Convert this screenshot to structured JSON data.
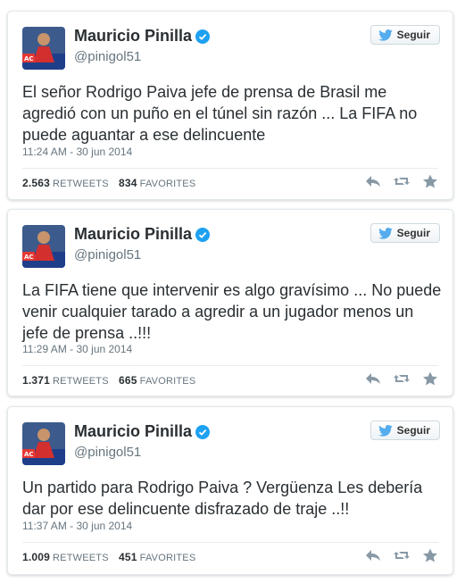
{
  "tweets": [
    {
      "display_name": "Mauricio Pinilla",
      "handle": "@pinigol51",
      "follow_label": "Seguir",
      "text": "El señor Rodrigo Paiva jefe de prensa de Brasil me agredió con un puño en el túnel sin razón ... La FIFA no puede aguantar a ese delincuente",
      "timestamp": "11:24 AM - 30 jun 2014",
      "retweets_count": "2.563",
      "retweets_label": "RETWEETS",
      "favorites_count": "834",
      "favorites_label": "FAVORITES"
    },
    {
      "display_name": "Mauricio Pinilla",
      "handle": "@pinigol51",
      "follow_label": "Seguir",
      "text": "La FIFA tiene que intervenir es algo gravísimo ... No puede venir cualquier tarado a agredir a un jugador menos un jefe de prensa ..!!!",
      "timestamp": "11:29 AM - 30 jun 2014",
      "retweets_count": "1.371",
      "retweets_label": "RETWEETS",
      "favorites_count": "665",
      "favorites_label": "FAVORITES"
    },
    {
      "display_name": "Mauricio Pinilla",
      "handle": "@pinigol51",
      "follow_label": "Seguir",
      "text": "Un partido para Rodrigo Paiva ? Vergüenza Les debería dar por ese delincuente disfrazado de traje ..!!",
      "timestamp": "11:37 AM - 30 jun 2014",
      "retweets_count": "1.009",
      "retweets_label": "RETWEETS",
      "favorites_count": "451",
      "favorites_label": "FAVORITES"
    }
  ],
  "colors": {
    "verified": "#1da1f2",
    "twitter_bird": "#55acee",
    "action_icons": "#8899a6"
  },
  "icons": [
    "verified-badge-icon",
    "twitter-bird-icon",
    "reply-icon",
    "retweet-icon",
    "favorite-star-icon"
  ]
}
